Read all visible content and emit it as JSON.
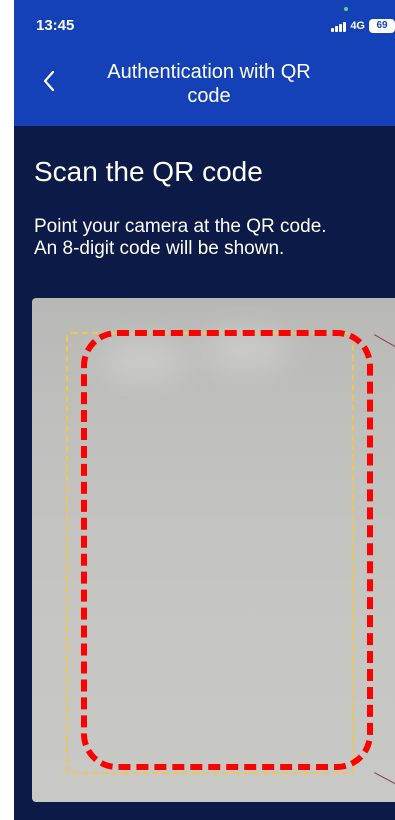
{
  "status_bar": {
    "time": "13:45",
    "network": "4G",
    "battery": "69"
  },
  "header": {
    "title_line_1": "Authentication with QR",
    "title_line_2": "code"
  },
  "main": {
    "title": "Scan the QR code",
    "instructions_line_1": "Point your camera at the QR code.",
    "instructions_line_2": "An 8-digit code will be shown."
  },
  "icons": {
    "back": "chevron-left-icon",
    "signal": "signal-bars-icon"
  },
  "colors": {
    "header_bg": "#1541b8",
    "content_bg": "#0b1a47",
    "scan_frame": "#f0c64d",
    "highlight": "#ff0000"
  }
}
